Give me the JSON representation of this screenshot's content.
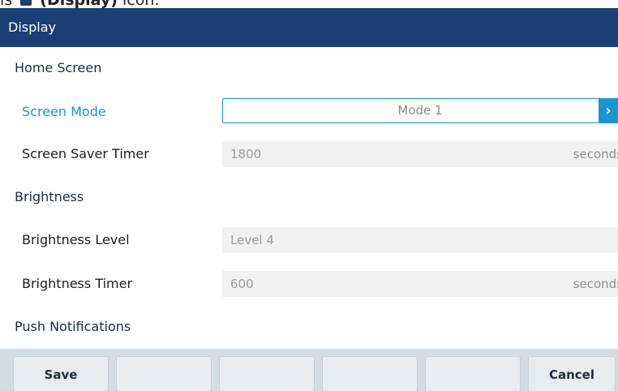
{
  "header_fragment": {
    "lead": "is",
    "label": "(Display)",
    "trail": "icon."
  },
  "title": "Display",
  "sections": {
    "home_screen": "Home Screen",
    "brightness": "Brightness",
    "push_notifications": "Push Notifications"
  },
  "rows": {
    "screen_mode": {
      "label": "Screen Mode",
      "value": "Mode 1"
    },
    "screen_saver_timer": {
      "label": "Screen Saver Timer",
      "value": "1800",
      "unit": "seconds"
    },
    "brightness_level": {
      "label": "Brightness Level",
      "value": "Level 4"
    },
    "brightness_timer": {
      "label": "Brightness Timer",
      "value": "600",
      "unit": "seconds"
    }
  },
  "softkeys": {
    "save": "Save",
    "key2": "",
    "key3": "",
    "key4": "",
    "key5": "",
    "cancel": "Cancel"
  },
  "colors": {
    "title_bar": "#1a3f75",
    "accent": "#1b94d4",
    "softkey_bar": "#d3dce1"
  },
  "icons": {
    "select_arrow": "chevron-right-icon",
    "display_icon": "display-icon"
  }
}
